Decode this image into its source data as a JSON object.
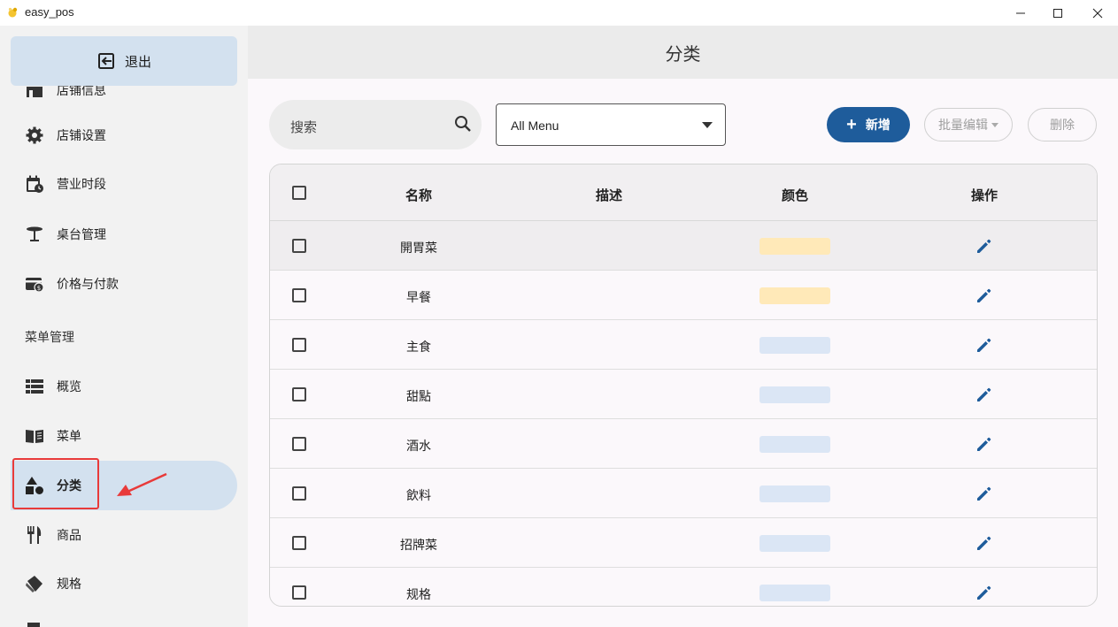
{
  "window": {
    "title": "easy_pos",
    "controls": [
      "minimize",
      "maximize",
      "close"
    ]
  },
  "sidebar": {
    "exit_label": "退出",
    "top_partial_label": "店铺信息",
    "items_settings": [
      {
        "label": "店铺设置",
        "icon": "gear-icon"
      },
      {
        "label": "营业时段",
        "icon": "calendar-clock-icon"
      },
      {
        "label": "桌台管理",
        "icon": "table-icon"
      },
      {
        "label": "价格与付款",
        "icon": "wallet-icon"
      }
    ],
    "section_menu": "菜单管理",
    "items_menu": [
      {
        "label": "概览",
        "icon": "list-icon"
      },
      {
        "label": "菜单",
        "icon": "book-icon"
      },
      {
        "label": "分类",
        "icon": "shapes-icon",
        "active": true
      },
      {
        "label": "商品",
        "icon": "utensils-icon"
      },
      {
        "label": "规格",
        "icon": "tag-icon"
      }
    ]
  },
  "header": {
    "title": "分类"
  },
  "toolbar": {
    "search_placeholder": "搜索",
    "select_value": "All Menu",
    "add_label": "新增",
    "batch_label": "批量编辑",
    "delete_label": "删除"
  },
  "table": {
    "columns": [
      "名称",
      "描述",
      "颜色",
      "操作"
    ],
    "rows": [
      {
        "name": "開胃菜",
        "description": "",
        "color": "#ffe9b8"
      },
      {
        "name": "早餐",
        "description": "",
        "color": "#ffe9b8"
      },
      {
        "name": "主食",
        "description": "",
        "color": "#dbe6f5"
      },
      {
        "name": "甜點",
        "description": "",
        "color": "#dbe6f5"
      },
      {
        "name": "酒水",
        "description": "",
        "color": "#dbe6f5"
      },
      {
        "name": "飲料",
        "description": "",
        "color": "#dbe6f5"
      },
      {
        "name": "招牌菜",
        "description": "",
        "color": "#dbe6f5"
      },
      {
        "name": "规格",
        "description": "",
        "color": "#dbe6f5"
      }
    ]
  },
  "colors": {
    "accent": "#1e5c9b",
    "active_nav": "#d3e1ef",
    "annotation": "#e83a3a"
  }
}
